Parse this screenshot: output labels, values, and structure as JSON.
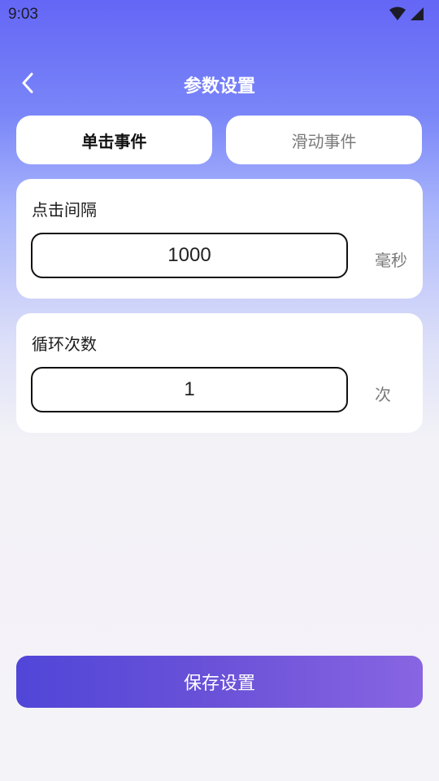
{
  "status_bar": {
    "time": "9:03",
    "icons": [
      "wifi-icon",
      "cellular-signal-icon"
    ]
  },
  "app_bar": {
    "back_icon": "chevron-left-icon",
    "title": "参数设置"
  },
  "tabs": [
    {
      "label": "单击事件",
      "selected": true
    },
    {
      "label": "滑动事件",
      "selected": false
    }
  ],
  "click_interval": {
    "label": "点击间隔",
    "value": "1000",
    "unit": "毫秒"
  },
  "loop_count": {
    "label": "循环次数",
    "value": "1",
    "unit": "次"
  },
  "save_button": {
    "label": "保存设置"
  },
  "colors": {
    "header_gradient_top": "#6466f5",
    "page_background": "#f4f3f8",
    "save_gradient_start": "#5046d8",
    "save_gradient_end": "#8865e2",
    "unit_text": "#7a7a7a"
  }
}
